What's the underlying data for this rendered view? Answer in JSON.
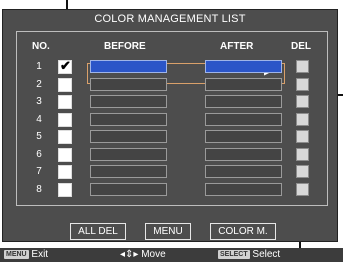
{
  "panel": {
    "title": "COLOR MANAGEMENT LIST",
    "headers": {
      "no": "NO.",
      "before": "BEFORE",
      "after": "AFTER",
      "del": "DEL"
    }
  },
  "rows": [
    {
      "no": "1",
      "checked": true
    },
    {
      "no": "2",
      "checked": false
    },
    {
      "no": "3",
      "checked": false
    },
    {
      "no": "4",
      "checked": false
    },
    {
      "no": "5",
      "checked": false
    },
    {
      "no": "6",
      "checked": false
    },
    {
      "no": "7",
      "checked": false
    },
    {
      "no": "8",
      "checked": false
    }
  ],
  "row1_arrow": "▶",
  "check_mark": "✔",
  "buttons": {
    "all_del": "ALL DEL",
    "menu": "MENU",
    "color_m": "COLOR M."
  },
  "footer": {
    "menu_tag": "MENU",
    "exit": "Exit",
    "move_arrows": "◂⇕▸",
    "move": "Move",
    "select_tag": "SELECT",
    "select": "Select"
  },
  "colors": {
    "selected_slot": "#2b55c8",
    "selection_frame": "#d9a06a",
    "panel_bg": "#4d4d4d"
  }
}
